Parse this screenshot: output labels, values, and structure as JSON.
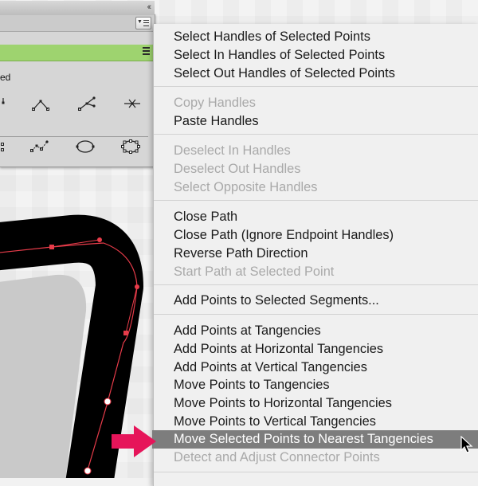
{
  "panel": {
    "collapse_glyph": "‹‹",
    "partial_label": "ed",
    "tool_icons": [
      "corner-point-icon",
      "convert-anchor-icon",
      "handles-split-icon",
      "cut-point-icon",
      "select-handles-icon",
      "select-points-icon",
      "ellipse-path-icon",
      "ellipse-points-icon"
    ]
  },
  "menu": {
    "items": [
      {
        "label": "Select Handles of Selected Points",
        "enabled": true
      },
      {
        "label": "Select In Handles of Selected Points",
        "enabled": true
      },
      {
        "label": "Select Out Handles of Selected Points",
        "enabled": true
      },
      {
        "label": "Copy Handles",
        "enabled": false
      },
      {
        "label": "Paste Handles",
        "enabled": true
      },
      {
        "label": "Deselect In Handles",
        "enabled": false
      },
      {
        "label": "Deselect Out Handles",
        "enabled": false
      },
      {
        "label": "Select Opposite Handles",
        "enabled": false
      },
      {
        "label": "Close Path",
        "enabled": true
      },
      {
        "label": "Close Path (Ignore Endpoint Handles)",
        "enabled": true
      },
      {
        "label": "Reverse Path Direction",
        "enabled": true
      },
      {
        "label": "Start Path at Selected Point",
        "enabled": false
      },
      {
        "label": "Add Points to Selected Segments...",
        "enabled": true
      },
      {
        "label": "Add Points at Tangencies",
        "enabled": true
      },
      {
        "label": "Add Points at Horizontal Tangencies",
        "enabled": true
      },
      {
        "label": "Add Points at Vertical Tangencies",
        "enabled": true
      },
      {
        "label": "Move Points to Tangencies",
        "enabled": true
      },
      {
        "label": "Move Points to Horizontal Tangencies",
        "enabled": true
      },
      {
        "label": "Move Points to Vertical Tangencies",
        "enabled": true
      },
      {
        "label": "Move Selected Points to Nearest Tangencies",
        "enabled": true,
        "highlighted": true
      },
      {
        "label": "Detect and Adjust Connector Points",
        "enabled": false
      }
    ]
  },
  "colors": {
    "highlight": "#7d7d7d",
    "panel_accent": "#9ed36f",
    "path_stroke": "#e83c4a",
    "callout_arrow": "#e6155a"
  }
}
